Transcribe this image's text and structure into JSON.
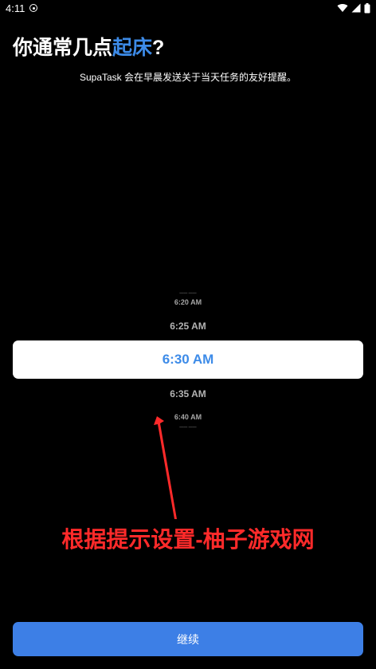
{
  "status_bar": {
    "time": "4:11",
    "icons": [
      "shield-icon",
      "wifi-icon",
      "signal-icon",
      "battery-icon"
    ]
  },
  "header": {
    "title_prefix": "你通常几点",
    "title_accent": "起床",
    "title_suffix": "?",
    "subtitle": "SupaTask 会在早晨发送关于当天任务的友好提醒。"
  },
  "time_picker": {
    "options": [
      "6:20 AM",
      "6:25 AM",
      "6:30 AM",
      "6:35 AM",
      "6:40 AM"
    ],
    "selected": "6:30 AM"
  },
  "overlay": {
    "watermark": "根据提示设置-柚子游戏网"
  },
  "footer": {
    "continue_label": "继续"
  },
  "colors": {
    "background": "#000000",
    "accent": "#3d8be8",
    "button": "#3d7fe6",
    "watermark": "#ff2a2a"
  }
}
